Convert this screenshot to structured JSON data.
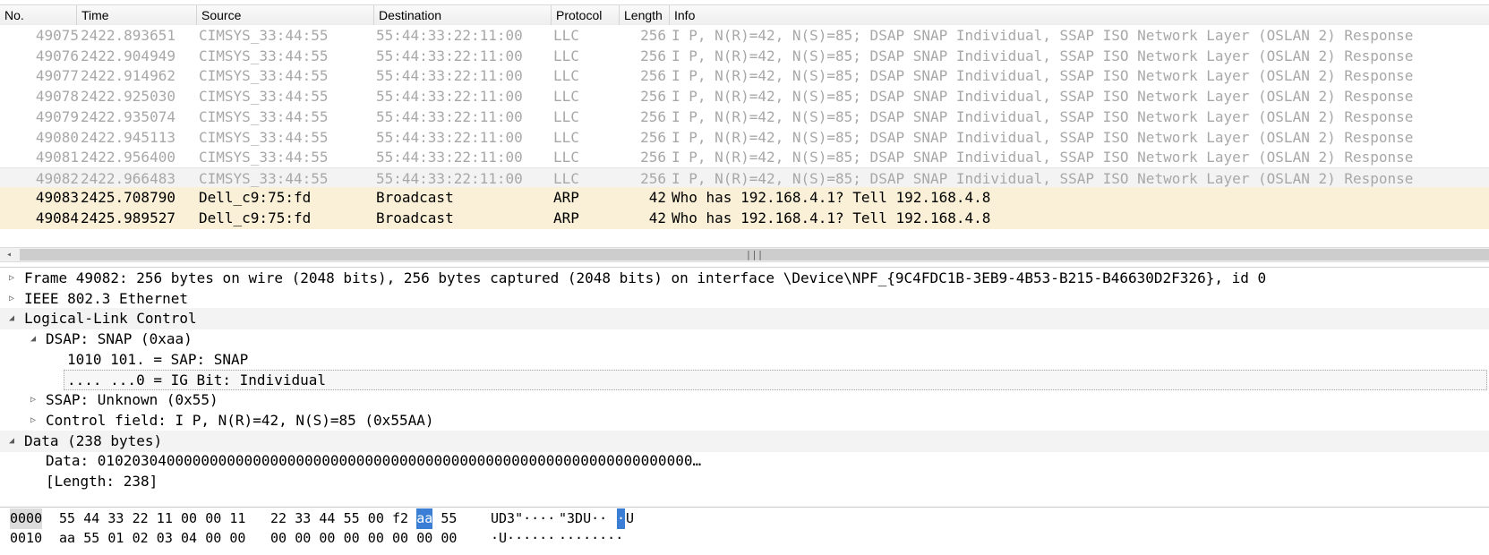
{
  "packet_list": {
    "columns": [
      "No.",
      "Time",
      "Source",
      "Destination",
      "Protocol",
      "Length",
      "Info"
    ],
    "rows": [
      {
        "no": "49075",
        "time": "2422.893651",
        "src": "CIMSYS_33:44:55",
        "dst": "55:44:33:22:11:00",
        "proto": "LLC",
        "len": "256",
        "info": "I P, N(R)=42, N(S)=85; DSAP SNAP Individual, SSAP ISO Network Layer (OSLAN 2) Response"
      },
      {
        "no": "49076",
        "time": "2422.904949",
        "src": "CIMSYS_33:44:55",
        "dst": "55:44:33:22:11:00",
        "proto": "LLC",
        "len": "256",
        "info": "I P, N(R)=42, N(S)=85; DSAP SNAP Individual, SSAP ISO Network Layer (OSLAN 2) Response"
      },
      {
        "no": "49077",
        "time": "2422.914962",
        "src": "CIMSYS_33:44:55",
        "dst": "55:44:33:22:11:00",
        "proto": "LLC",
        "len": "256",
        "info": "I P, N(R)=42, N(S)=85; DSAP SNAP Individual, SSAP ISO Network Layer (OSLAN 2) Response"
      },
      {
        "no": "49078",
        "time": "2422.925030",
        "src": "CIMSYS_33:44:55",
        "dst": "55:44:33:22:11:00",
        "proto": "LLC",
        "len": "256",
        "info": "I P, N(R)=42, N(S)=85; DSAP SNAP Individual, SSAP ISO Network Layer (OSLAN 2) Response"
      },
      {
        "no": "49079",
        "time": "2422.935074",
        "src": "CIMSYS_33:44:55",
        "dst": "55:44:33:22:11:00",
        "proto": "LLC",
        "len": "256",
        "info": "I P, N(R)=42, N(S)=85; DSAP SNAP Individual, SSAP ISO Network Layer (OSLAN 2) Response"
      },
      {
        "no": "49080",
        "time": "2422.945113",
        "src": "CIMSYS_33:44:55",
        "dst": "55:44:33:22:11:00",
        "proto": "LLC",
        "len": "256",
        "info": "I P, N(R)=42, N(S)=85; DSAP SNAP Individual, SSAP ISO Network Layer (OSLAN 2) Response"
      },
      {
        "no": "49081",
        "time": "2422.956400",
        "src": "CIMSYS_33:44:55",
        "dst": "55:44:33:22:11:00",
        "proto": "LLC",
        "len": "256",
        "info": "I P, N(R)=42, N(S)=85; DSAP SNAP Individual, SSAP ISO Network Layer (OSLAN 2) Response"
      },
      {
        "no": "49082",
        "time": "2422.966483",
        "src": "CIMSYS_33:44:55",
        "dst": "55:44:33:22:11:00",
        "proto": "LLC",
        "len": "256",
        "info": "I P, N(R)=42, N(S)=85; DSAP SNAP Individual, SSAP ISO Network Layer (OSLAN 2) Response"
      },
      {
        "no": "49083",
        "time": "2425.708790",
        "src": "Dell_c9:75:fd",
        "dst": "Broadcast",
        "proto": "ARP",
        "len": "42",
        "info": "Who has 192.168.4.1? Tell 192.168.4.8"
      },
      {
        "no": "49084",
        "time": "2425.989527",
        "src": "Dell_c9:75:fd",
        "dst": "Broadcast",
        "proto": "ARP",
        "len": "42",
        "info": "Who has 192.168.4.1? Tell 192.168.4.8"
      }
    ],
    "scroll_left_icon": "◂",
    "scroll_grip_icon": "|||"
  },
  "details": {
    "lines": [
      {
        "text": "Frame 49082: 256 bytes on wire (2048 bits), 256 bytes captured (2048 bits) on interface \\Device\\NPF_{9C4FDC1B-3EB9-4B53-B215-B46630D2F326}, id 0",
        "toggle": "▷"
      },
      {
        "text": "IEEE 802.3 Ethernet",
        "toggle": "▷"
      },
      {
        "text": "Logical-Link Control",
        "toggle": "◢"
      },
      {
        "text": "DSAP: SNAP (0xaa)",
        "toggle": "◢"
      },
      {
        "text": "1010 101. = SAP: SNAP",
        "toggle": ""
      },
      {
        "text": ".... ...0 = IG Bit: Individual",
        "toggle": ""
      },
      {
        "text": "SSAP: Unknown (0x55)",
        "toggle": "▷"
      },
      {
        "text": "Control field: I P, N(R)=42, N(S)=85 (0x55AA)",
        "toggle": "▷"
      },
      {
        "text": "Data (238 bytes)",
        "toggle": "◢"
      },
      {
        "text": "Data: 010203040000000000000000000000000000000000000000000000000000000000000…",
        "toggle": ""
      },
      {
        "text": "[Length: 238]",
        "toggle": ""
      }
    ]
  },
  "bytes": {
    "lines": [
      {
        "offset": "0000",
        "hex1": [
          "55",
          "44",
          "33",
          "22",
          "11",
          "00",
          "00",
          "11"
        ],
        "hex2": [
          "22",
          "33",
          "44",
          "55",
          "00",
          "f2",
          "aa",
          "55"
        ],
        "ascii1": "UD3\"····",
        "ascii2a": " \"3DU··",
        "ascii2b": "·",
        "ascii2c": "U"
      },
      {
        "offset": "0010",
        "hex1": [
          "aa",
          "55",
          "01",
          "02",
          "03",
          "04",
          "00",
          "00"
        ],
        "hex2": [
          "00",
          "00",
          "00",
          "00",
          "00",
          "00",
          "00",
          "00"
        ],
        "ascii1": "·U······",
        "ascii2a": " ········",
        "ascii2b": "",
        "ascii2c": ""
      }
    ]
  },
  "colors": {
    "arp_row": "#faf0d7",
    "selection": "#3a7fd5",
    "dim_text": "#a8a8a8"
  }
}
